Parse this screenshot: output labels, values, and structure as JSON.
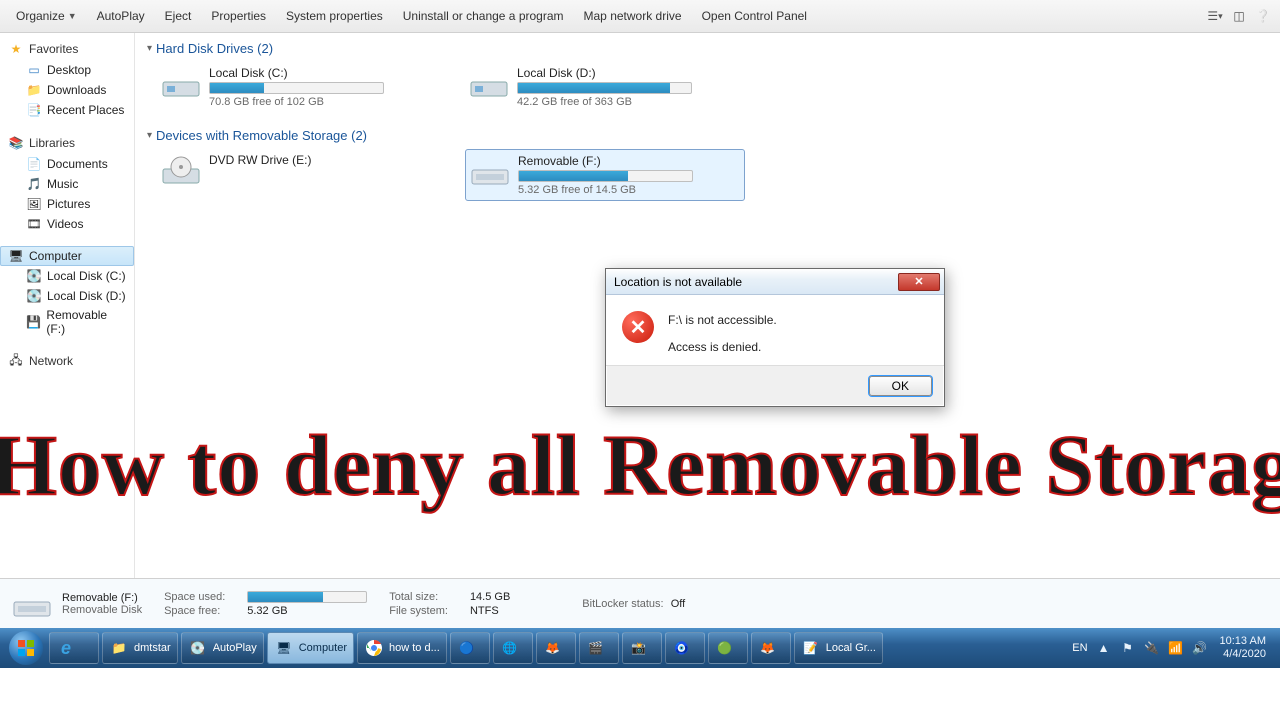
{
  "toolbar": {
    "organize": "Organize",
    "autoplay": "AutoPlay",
    "eject": "Eject",
    "properties": "Properties",
    "system_properties": "System properties",
    "uninstall": "Uninstall or change a program",
    "map_drive": "Map network drive",
    "open_cp": "Open Control Panel"
  },
  "sidebar": {
    "favorites": {
      "label": "Favorites",
      "items": [
        "Desktop",
        "Downloads",
        "Recent Places"
      ]
    },
    "libraries": {
      "label": "Libraries",
      "items": [
        "Documents",
        "Music",
        "Pictures",
        "Videos"
      ]
    },
    "computer": {
      "label": "Computer",
      "items": [
        "Local Disk (C:)",
        "Local Disk (D:)",
        "Removable (F:)"
      ]
    },
    "network": {
      "label": "Network"
    }
  },
  "groups": {
    "hdd": {
      "title": "Hard Disk Drives (2)"
    },
    "removable": {
      "title": "Devices with Removable Storage (2)"
    }
  },
  "drives": {
    "c": {
      "name": "Local Disk (C:)",
      "free": "70.8 GB free of 102 GB",
      "fill": 31
    },
    "d": {
      "name": "Local Disk (D:)",
      "free": "42.2 GB free of 363 GB",
      "fill": 88
    },
    "dvd": {
      "name": "DVD RW Drive (E:)"
    },
    "f": {
      "name": "Removable (F:)",
      "free": "5.32 GB free of 14.5 GB",
      "fill": 63
    }
  },
  "dialog": {
    "title": "Location is not available",
    "line1": "F:\\ is not accessible.",
    "line2": "Access is denied.",
    "ok": "OK"
  },
  "overlay": "How to deny all Removable Storage Device",
  "details": {
    "name": "Removable (F:)",
    "type": "Removable Disk",
    "space_used_label": "Space used:",
    "space_free_label": "Space free:",
    "space_free": "5.32 GB",
    "total_label": "Total size:",
    "total": "14.5 GB",
    "fs_label": "File system:",
    "fs": "NTFS",
    "bl_label": "BitLocker status:",
    "bl": "Off",
    "fill": 63
  },
  "taskbar": {
    "items": [
      {
        "label": "",
        "id": "ie"
      },
      {
        "label": "dmtstar",
        "id": "folder"
      },
      {
        "label": "AutoPlay",
        "id": "autoplay"
      },
      {
        "label": "Computer",
        "id": "computer",
        "active": true
      },
      {
        "label": "how to d...",
        "id": "chrome"
      },
      {
        "label": "",
        "id": "app1"
      },
      {
        "label": "",
        "id": "app2"
      },
      {
        "label": "",
        "id": "app3"
      },
      {
        "label": "",
        "id": "app4"
      },
      {
        "label": "",
        "id": "app5"
      },
      {
        "label": "",
        "id": "app6"
      },
      {
        "label": "",
        "id": "app7"
      },
      {
        "label": "",
        "id": "firefox"
      },
      {
        "label": "Local Gr...",
        "id": "notepad"
      }
    ],
    "lang": "EN",
    "time": "10:13 AM",
    "date": "4/4/2020"
  }
}
